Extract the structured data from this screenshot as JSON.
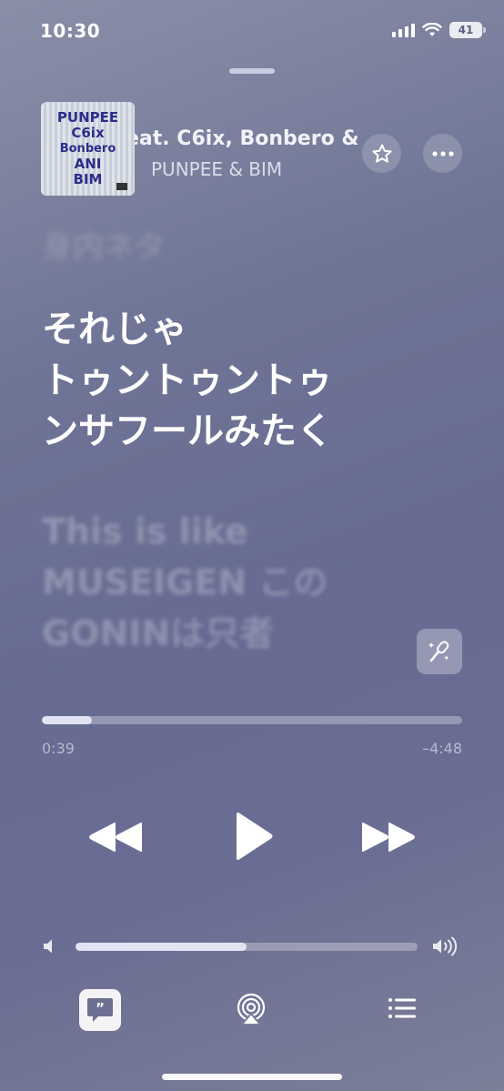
{
  "status_bar": {
    "time": "10:30",
    "battery": "41"
  },
  "track": {
    "title": "eat. C6ix, Bonbero &",
    "artist": "PUNPEE & BIM",
    "artwork_text": [
      "PUNPEE",
      "C6ix",
      "Bonbero",
      "ANI",
      "BIM"
    ]
  },
  "lyrics": {
    "previous": "身内ネタ",
    "current": [
      "それじゃ",
      "トゥントゥントゥ",
      "ンサフールみたく"
    ],
    "next": [
      "This is like",
      "MUSEIGEN この",
      "GONINは只者"
    ]
  },
  "playback": {
    "elapsed": "0:39",
    "remaining": "–4:48",
    "progress_fraction": 0.12,
    "volume_fraction": 0.5
  },
  "icons": {
    "favorite": "star-icon",
    "more": "ellipsis-icon",
    "sing": "microphone-icon",
    "rewind": "rewind-icon",
    "play": "play-icon",
    "forward": "forward-icon",
    "volume_low": "speaker-low-icon",
    "volume_high": "speaker-high-icon",
    "lyrics": "lyrics-quote-icon",
    "airplay": "airplay-icon",
    "queue": "list-icon"
  }
}
